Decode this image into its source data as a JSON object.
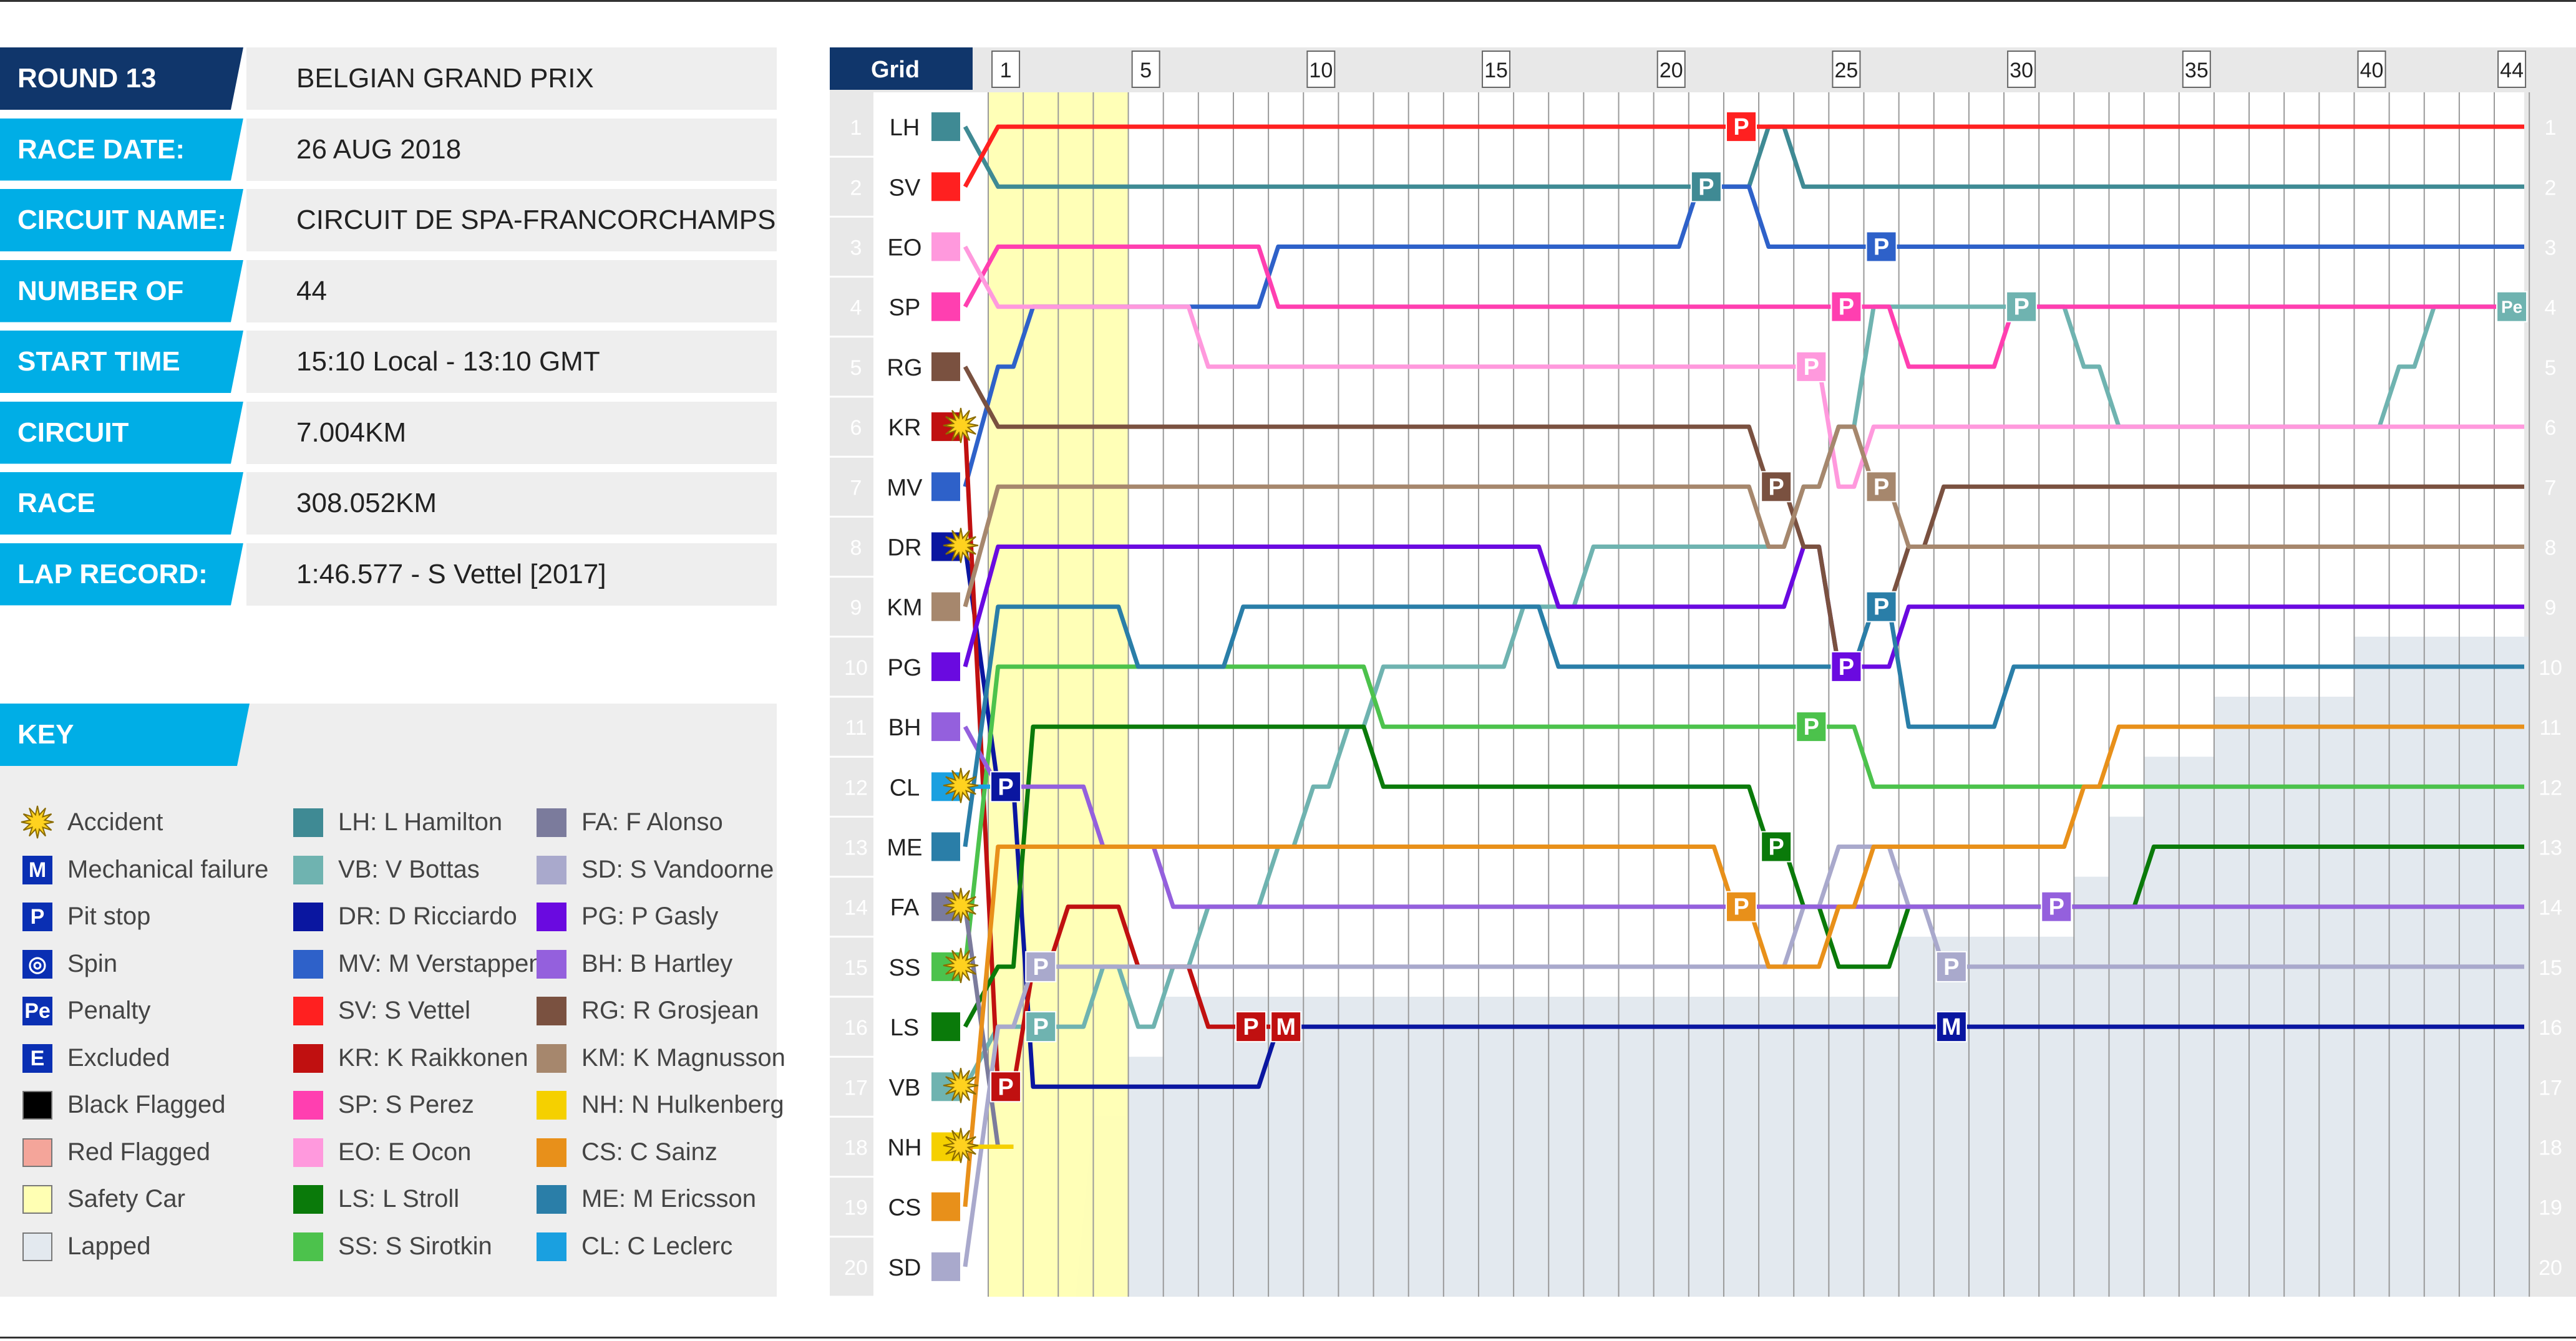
{
  "info": [
    {
      "label": "ROUND 13",
      "value": "BELGIAN GRAND PRIX"
    },
    {
      "label": "RACE DATE:",
      "value": "26 AUG 2018"
    },
    {
      "label": "CIRCUIT NAME:",
      "value": "CIRCUIT DE SPA-FRANCORCHAMPS"
    },
    {
      "label": "NUMBER OF LAPS:",
      "value": "44"
    },
    {
      "label": "START TIME",
      "value": "15:10 Local - 13:10 GMT"
    },
    {
      "label": "CIRCUIT LENGTH:",
      "value": "7.004KM"
    },
    {
      "label": "RACE DISTANCE:",
      "value": "308.052KM"
    },
    {
      "label": "LAP RECORD:",
      "value": "1:46.577 - S Vettel [2017]"
    }
  ],
  "key": {
    "title": "KEY",
    "symbols": [
      {
        "icon": "accident-icon",
        "label": "Accident"
      },
      {
        "icon": "mechanical-failure-icon",
        "glyph": "M",
        "label": "Mechanical failure"
      },
      {
        "icon": "pit-stop-icon",
        "glyph": "P",
        "label": "Pit stop"
      },
      {
        "icon": "spin-icon",
        "glyph": "◎",
        "label": "Spin"
      },
      {
        "icon": "penalty-icon",
        "glyph": "Pe",
        "label": "Penalty"
      },
      {
        "icon": "excluded-icon",
        "glyph": "E",
        "label": "Excluded"
      },
      {
        "icon": "black-flag-icon",
        "color": "#000000",
        "label": "Black Flagged"
      },
      {
        "icon": "red-flag-icon",
        "color": "#f4a59a",
        "label": "Red Flagged"
      },
      {
        "icon": "safety-car-icon",
        "color": "#ffffb3",
        "label": "Safety Car"
      },
      {
        "icon": "lapped-icon",
        "color": "#e3e9ef",
        "label": "Lapped"
      }
    ],
    "drivers_col1": [
      "LH",
      "VB",
      "DR",
      "MV",
      "SV",
      "KR",
      "SP",
      "EO",
      "LS",
      "SS"
    ],
    "drivers_col2": [
      "FA",
      "SD",
      "PG",
      "BH",
      "RG",
      "KM",
      "NH",
      "CS",
      "ME",
      "CL"
    ]
  },
  "chart_data": {
    "type": "line",
    "title": "",
    "grid_label": "Grid",
    "laps": 44,
    "lap_ticks": [
      1,
      5,
      10,
      15,
      20,
      25,
      30,
      35,
      40,
      44
    ],
    "positions": [
      1,
      2,
      3,
      4,
      5,
      6,
      7,
      8,
      9,
      10,
      11,
      12,
      13,
      14,
      15,
      16,
      17,
      18,
      19,
      20
    ],
    "safety_car_laps": [
      1,
      4
    ],
    "ylim": [
      1,
      20
    ],
    "drivers": [
      {
        "code": "LH",
        "name": "L Hamilton",
        "color": "#3f8a94",
        "grid": 1,
        "positions": [
          2,
          2,
          2,
          2,
          2,
          2,
          2,
          2,
          2,
          2,
          2,
          2,
          2,
          2,
          2,
          2,
          2,
          2,
          2,
          2,
          2,
          2,
          1,
          2,
          2,
          2,
          2,
          2,
          2,
          2,
          2,
          2,
          2,
          2,
          2,
          2,
          2,
          2,
          2,
          2,
          2,
          2,
          2,
          2
        ],
        "events": [
          {
            "type": "P",
            "lap": 21
          }
        ]
      },
      {
        "code": "VB",
        "name": "V Bottas",
        "color": "#6fb3b0",
        "grid": 17,
        "positions": [
          16,
          16,
          16,
          15,
          16,
          15,
          14,
          14,
          13,
          12,
          11,
          10,
          10,
          10,
          10,
          9,
          9,
          8,
          8,
          8,
          8,
          8,
          8,
          7,
          6,
          4,
          4,
          4,
          4,
          4,
          4,
          5,
          6,
          6,
          6,
          6,
          6,
          6,
          6,
          6,
          5,
          4,
          4,
          4
        ],
        "events": [
          {
            "type": "P",
            "lap": 2
          },
          {
            "type": "P",
            "lap": 30
          },
          {
            "type": "Pe",
            "lap": 44
          }
        ]
      },
      {
        "code": "DR",
        "name": "D Ricciardo",
        "color": "#0a16a0",
        "grid": 8,
        "positions": [
          12,
          17,
          17,
          17,
          17,
          17,
          17,
          17,
          16,
          16,
          16,
          16,
          16,
          16,
          16,
          16,
          16,
          16,
          16,
          16,
          16,
          16,
          16,
          16,
          16,
          16,
          16,
          16,
          16,
          16,
          16,
          16,
          16,
          16,
          16,
          16,
          16,
          16,
          16,
          16,
          16,
          16,
          16,
          16
        ],
        "events": [
          {
            "type": "P",
            "lap": 1
          },
          {
            "type": "M",
            "lap": 28
          }
        ]
      },
      {
        "code": "MV",
        "name": "M Verstappen",
        "color": "#2e61c9",
        "grid": 7,
        "positions": [
          5,
          4,
          4,
          4,
          4,
          4,
          4,
          4,
          3,
          3,
          3,
          3,
          3,
          3,
          3,
          3,
          3,
          3,
          3,
          3,
          2,
          2,
          3,
          3,
          3,
          3,
          3,
          3,
          3,
          3,
          3,
          3,
          3,
          3,
          3,
          3,
          3,
          3,
          3,
          3,
          3,
          3,
          3,
          3
        ],
        "events": [
          {
            "type": "P",
            "lap": 26
          }
        ]
      },
      {
        "code": "SV",
        "name": "S Vettel",
        "color": "#ff2020",
        "grid": 2,
        "positions": [
          1,
          1,
          1,
          1,
          1,
          1,
          1,
          1,
          1,
          1,
          1,
          1,
          1,
          1,
          1,
          1,
          1,
          1,
          1,
          1,
          1,
          1,
          1,
          1,
          1,
          1,
          1,
          1,
          1,
          1,
          1,
          1,
          1,
          1,
          1,
          1,
          1,
          1,
          1,
          1,
          1,
          1,
          1,
          1
        ],
        "events": [
          {
            "type": "P",
            "lap": 22
          }
        ]
      },
      {
        "code": "KR",
        "name": "K Raikkonen",
        "color": "#c01010",
        "grid": 6,
        "positions": [
          17,
          15,
          14,
          14,
          15,
          15,
          16,
          16,
          16,
          16,
          16,
          16,
          16,
          16,
          16,
          16,
          16,
          16,
          16,
          16,
          16,
          16,
          16,
          16,
          16,
          16,
          16,
          16,
          16,
          16,
          16,
          16,
          16,
          16,
          16,
          16,
          16,
          16,
          16,
          16,
          16,
          16,
          16,
          16
        ],
        "events": [
          {
            "type": "P",
            "lap": 1
          },
          {
            "type": "P",
            "lap": 8
          },
          {
            "type": "M",
            "lap": 9
          }
        ],
        "retired_lap": 9
      },
      {
        "code": "SP",
        "name": "S Perez",
        "color": "#ff3fb0",
        "grid": 4,
        "positions": [
          3,
          3,
          3,
          3,
          3,
          3,
          3,
          3,
          4,
          4,
          4,
          4,
          4,
          4,
          4,
          4,
          4,
          4,
          4,
          4,
          4,
          4,
          4,
          4,
          4,
          4,
          5,
          5,
          5,
          4,
          4,
          4,
          4,
          4,
          4,
          4,
          4,
          4,
          4,
          4,
          4,
          4,
          4,
          4
        ],
        "events": [
          {
            "type": "P",
            "lap": 25
          }
        ]
      },
      {
        "code": "EO",
        "name": "E Ocon",
        "color": "#ff99dd",
        "grid": 3,
        "positions": [
          4,
          4,
          4,
          4,
          4,
          4,
          5,
          5,
          5,
          5,
          5,
          5,
          5,
          5,
          5,
          5,
          5,
          5,
          5,
          5,
          5,
          5,
          5,
          5,
          7,
          6,
          6,
          6,
          6,
          6,
          6,
          6,
          6,
          6,
          6,
          6,
          6,
          6,
          6,
          6,
          6,
          6,
          6,
          6
        ],
        "events": [
          {
            "type": "P",
            "lap": 24
          }
        ]
      },
      {
        "code": "LS",
        "name": "L Stroll",
        "color": "#0a7a0a",
        "grid": 16,
        "positions": [
          15,
          11,
          11,
          11,
          11,
          11,
          11,
          11,
          11,
          11,
          11,
          12,
          12,
          12,
          12,
          12,
          12,
          12,
          12,
          12,
          12,
          12,
          13,
          14,
          15,
          15,
          14,
          14,
          14,
          14,
          14,
          14,
          14,
          13,
          13,
          13,
          13,
          13,
          13,
          13,
          13,
          13,
          13,
          13
        ],
        "events": [
          {
            "type": "P",
            "lap": 23
          }
        ]
      },
      {
        "code": "SS",
        "name": "S Sirotkin",
        "color": "#4cc24c",
        "grid": 15,
        "positions": [
          10,
          10,
          10,
          10,
          10,
          10,
          10,
          10,
          10,
          10,
          10,
          11,
          11,
          11,
          11,
          11,
          11,
          11,
          11,
          11,
          11,
          11,
          11,
          11,
          11,
          12,
          12,
          12,
          12,
          12,
          12,
          12,
          12,
          12,
          12,
          12,
          12,
          12,
          12,
          12,
          12,
          12,
          12,
          12
        ],
        "events": [
          {
            "type": "P",
            "lap": 24
          }
        ]
      },
      {
        "code": "FA",
        "name": "F Alonso",
        "color": "#7b7b9c",
        "grid": 14,
        "positions": [
          18,
          18,
          18,
          18,
          18,
          18,
          18,
          18,
          18,
          18,
          18,
          18,
          18,
          18,
          18,
          18,
          18,
          18,
          18,
          18,
          18,
          18,
          18,
          18,
          18,
          18,
          18,
          18,
          18,
          18,
          18,
          18,
          18,
          18,
          18,
          18,
          18,
          18,
          18,
          18,
          18,
          18,
          18,
          18
        ],
        "retired_lap": 1
      },
      {
        "code": "SD",
        "name": "S Vandoorne",
        "color": "#a9a9cc",
        "grid": 20,
        "positions": [
          16,
          15,
          15,
          15,
          15,
          15,
          15,
          15,
          15,
          15,
          15,
          15,
          15,
          15,
          15,
          15,
          15,
          15,
          15,
          15,
          15,
          15,
          15,
          14,
          13,
          13,
          14,
          15,
          15,
          15,
          15,
          15,
          15,
          15,
          15,
          15,
          15,
          15,
          15,
          15,
          15,
          15,
          15,
          15
        ],
        "events": [
          {
            "type": "P",
            "lap": 2
          },
          {
            "type": "P",
            "lap": 28
          }
        ]
      },
      {
        "code": "PG",
        "name": "P Gasly",
        "color": "#6a0ae0",
        "grid": 10,
        "positions": [
          8,
          8,
          8,
          8,
          8,
          8,
          8,
          8,
          8,
          8,
          8,
          8,
          8,
          8,
          8,
          8,
          9,
          9,
          9,
          9,
          9,
          9,
          9,
          8,
          10,
          10,
          9,
          9,
          9,
          9,
          9,
          9,
          9,
          9,
          9,
          9,
          9,
          9,
          9,
          9,
          9,
          9,
          9,
          9
        ],
        "events": [
          {
            "type": "P",
            "lap": 25
          }
        ]
      },
      {
        "code": "BH",
        "name": "B Hartley",
        "color": "#9460dd",
        "grid": 11,
        "positions": [
          12,
          12,
          12,
          13,
          13,
          14,
          14,
          14,
          14,
          14,
          14,
          14,
          14,
          14,
          14,
          14,
          14,
          14,
          14,
          14,
          14,
          14,
          14,
          14,
          14,
          14,
          14,
          14,
          14,
          14,
          14,
          14,
          14,
          14,
          14,
          14,
          14,
          14,
          14,
          14,
          14,
          14,
          14,
          14
        ],
        "events": [
          {
            "type": "P",
            "lap": 31
          }
        ]
      },
      {
        "code": "RG",
        "name": "R Grosjean",
        "color": "#7a5140",
        "grid": 5,
        "positions": [
          6,
          6,
          6,
          6,
          6,
          6,
          6,
          6,
          6,
          6,
          6,
          6,
          6,
          6,
          6,
          6,
          6,
          6,
          6,
          6,
          6,
          6,
          7,
          8,
          10,
          9,
          8,
          7,
          7,
          7,
          7,
          7,
          7,
          7,
          7,
          7,
          7,
          7,
          7,
          7,
          7,
          7,
          7,
          7
        ],
        "events": [
          {
            "type": "P",
            "lap": 23
          }
        ]
      },
      {
        "code": "KM",
        "name": "K Magnusson",
        "color": "#a6876d",
        "grid": 9,
        "positions": [
          7,
          7,
          7,
          7,
          7,
          7,
          7,
          7,
          7,
          7,
          7,
          7,
          7,
          7,
          7,
          7,
          7,
          7,
          7,
          7,
          7,
          7,
          8,
          7,
          6,
          7,
          8,
          8,
          8,
          8,
          8,
          8,
          8,
          8,
          8,
          8,
          8,
          8,
          8,
          8,
          8,
          8,
          8,
          8
        ],
        "events": [
          {
            "type": "P",
            "lap": 26
          }
        ]
      },
      {
        "code": "NH",
        "name": "N Hulkenberg",
        "color": "#f5d000",
        "grid": 18,
        "positions": [
          18,
          18,
          18,
          18,
          18,
          18,
          18,
          18,
          18,
          18,
          18,
          18,
          18,
          18,
          18,
          18,
          18,
          18,
          18,
          18,
          18,
          18,
          18,
          18,
          18,
          18,
          18,
          18,
          18,
          18,
          18,
          18,
          18,
          18,
          18,
          18,
          18,
          18,
          18,
          18,
          18,
          18,
          18,
          18
        ],
        "retired_lap": 1
      },
      {
        "code": "CS",
        "name": "C Sainz",
        "color": "#e8901a",
        "grid": 19,
        "positions": [
          13,
          13,
          13,
          13,
          13,
          13,
          13,
          13,
          13,
          13,
          13,
          13,
          13,
          13,
          13,
          13,
          13,
          13,
          13,
          13,
          13,
          14,
          15,
          15,
          14,
          13,
          13,
          13,
          13,
          13,
          13,
          12,
          11,
          11,
          11,
          11,
          11,
          11,
          11,
          11,
          11,
          11,
          11,
          11
        ],
        "events": [
          {
            "type": "P",
            "lap": 22
          }
        ]
      },
      {
        "code": "ME",
        "name": "M Ericsson",
        "color": "#2a7ea8",
        "grid": 13,
        "positions": [
          9,
          9,
          9,
          9,
          10,
          10,
          10,
          9,
          9,
          9,
          9,
          9,
          9,
          9,
          9,
          9,
          10,
          10,
          10,
          10,
          10,
          10,
          10,
          10,
          10,
          9,
          11,
          11,
          11,
          10,
          10,
          10,
          10,
          10,
          10,
          10,
          10,
          10,
          10,
          10,
          10,
          10,
          10,
          10
        ],
        "events": [
          {
            "type": "P",
            "lap": 26
          }
        ]
      },
      {
        "code": "CL",
        "name": "C Leclerc",
        "color": "#1aa0e0",
        "grid": 12,
        "positions": [
          12,
          12,
          12,
          12,
          12,
          12,
          12,
          12,
          12,
          12,
          12,
          12,
          12,
          12,
          12,
          12,
          12,
          12,
          12,
          12,
          12,
          12,
          12,
          12,
          12,
          12,
          12,
          12,
          12,
          12,
          12,
          12,
          12,
          12,
          12,
          12,
          12,
          12,
          12,
          12,
          12,
          12,
          12,
          12
        ],
        "retired_lap": 1
      }
    ]
  }
}
